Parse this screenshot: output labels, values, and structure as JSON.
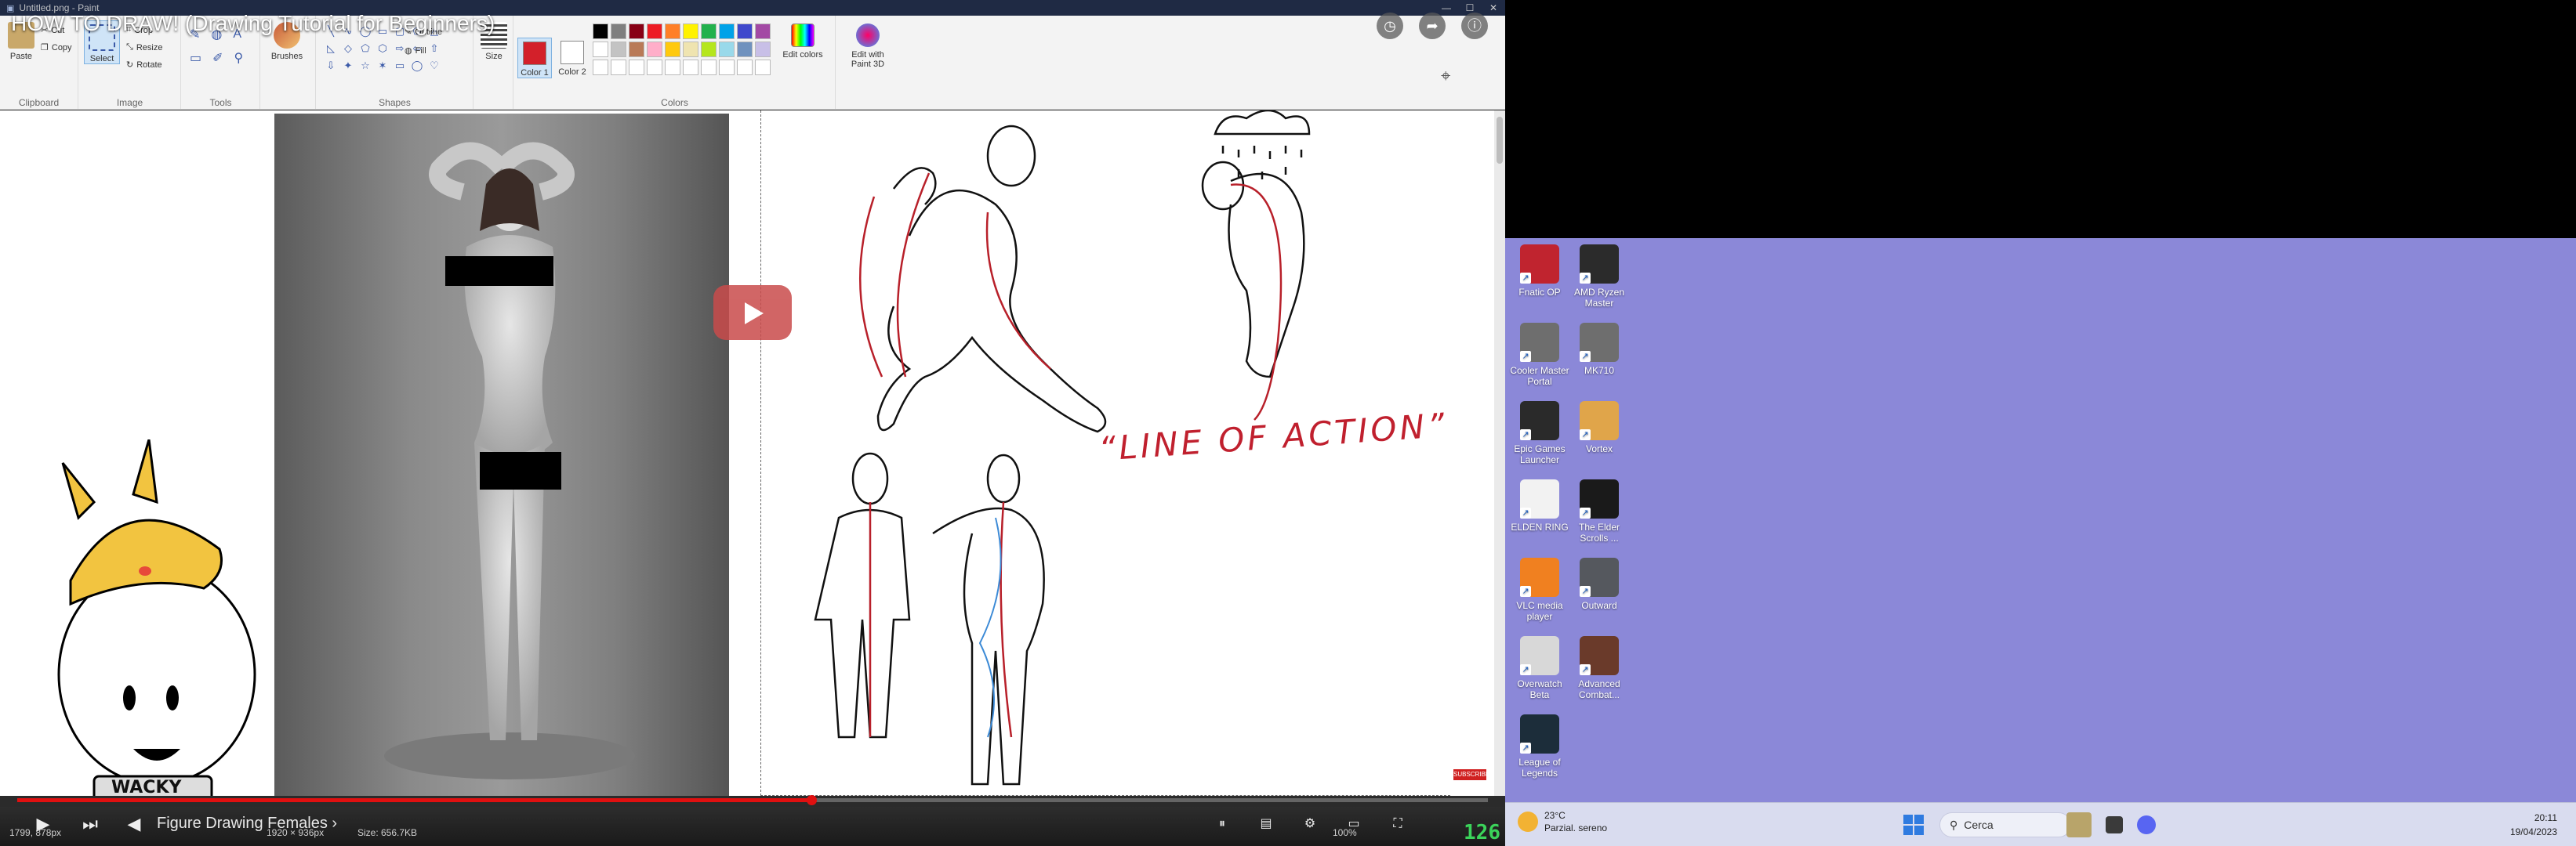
{
  "paint": {
    "window_title": "Untitled.png - Paint",
    "window_controls": [
      "—",
      "☐",
      "✕"
    ],
    "clipboard": {
      "paste": "Paste",
      "cut": "Cut",
      "copy": "Copy",
      "group": "Clipboard"
    },
    "image": {
      "select": "Select",
      "crop": "Crop",
      "resize": "Resize",
      "rotate": "Rotate",
      "group": "Image"
    },
    "tools": {
      "group": "Tools"
    },
    "brushes": "Brushes",
    "shapes": {
      "outline": "Outline",
      "fill": "Fill",
      "group": "Shapes"
    },
    "size": "Size",
    "color1": "Color 1",
    "color2": "Color 2",
    "colors_group": "Colors",
    "edit_colors": "Edit colors",
    "edit_paint3d": "Edit with Paint 3D",
    "color1_value": "#d3202a",
    "color2_value": "#ffffff",
    "palette": [
      "#000000",
      "#7f7f7f",
      "#880015",
      "#ed1c24",
      "#ff7f27",
      "#fff200",
      "#22b14c",
      "#00a2e8",
      "#3f48cc",
      "#a349a4",
      "#ffffff",
      "#c3c3c3",
      "#b97a57",
      "#ffaec9",
      "#ffc90e",
      "#efe4b0",
      "#b5e61d",
      "#99d9ea",
      "#7092be",
      "#c8bfe7",
      "#ffffff",
      "#ffffff",
      "#ffffff",
      "#ffffff",
      "#ffffff",
      "#ffffff",
      "#ffffff",
      "#ffffff",
      "#ffffff",
      "#ffffff"
    ]
  },
  "video": {
    "title": "HOW TO DRAW! (Drawing Tutorial for Beginners)",
    "chapter": "Figure Drawing Females ›",
    "line_of_action": "“LINE OF ACTION”",
    "mascot_label": "WACKY",
    "subscribe": "SUBSCRIBE",
    "progress_fraction": 0.54,
    "counter": "126"
  },
  "paint_status": {
    "position": "1799, 878px",
    "selection": "1920 × 936px",
    "file_size": "Size: 656.7KB",
    "zoom": "100%"
  },
  "desktop": {
    "icons": [
      {
        "label": "Fnatic OP",
        "color": "#c0242f"
      },
      {
        "label": "AMD Ryzen Master",
        "color": "#2b2b2b"
      },
      {
        "label": "Cooler Master Portal",
        "color": "#6e6e6e"
      },
      {
        "label": "MK710",
        "color": "#6e6e6e"
      },
      {
        "label": "Epic Games Launcher",
        "color": "#2a2a2a"
      },
      {
        "label": "Vortex",
        "color": "#e0a54a"
      },
      {
        "label": "ELDEN RING",
        "color": "#f2f2f2"
      },
      {
        "label": "The Elder Scrolls ...",
        "color": "#1a1a1a"
      },
      {
        "label": "VLC media player",
        "color": "#f08020"
      },
      {
        "label": "Outward",
        "color": "#55585e"
      },
      {
        "label": "Overwatch Beta",
        "color": "#d8d8d8"
      },
      {
        "label": "Advanced Combat...",
        "color": "#6a3a2a"
      },
      {
        "label": "League of Legends",
        "color": "#1c2d3a"
      }
    ]
  },
  "taskbar": {
    "temperature": "23°C",
    "weather": "Parzial. sereno",
    "search": "Cerca",
    "time": "20:11",
    "date": "19/04/2023"
  }
}
